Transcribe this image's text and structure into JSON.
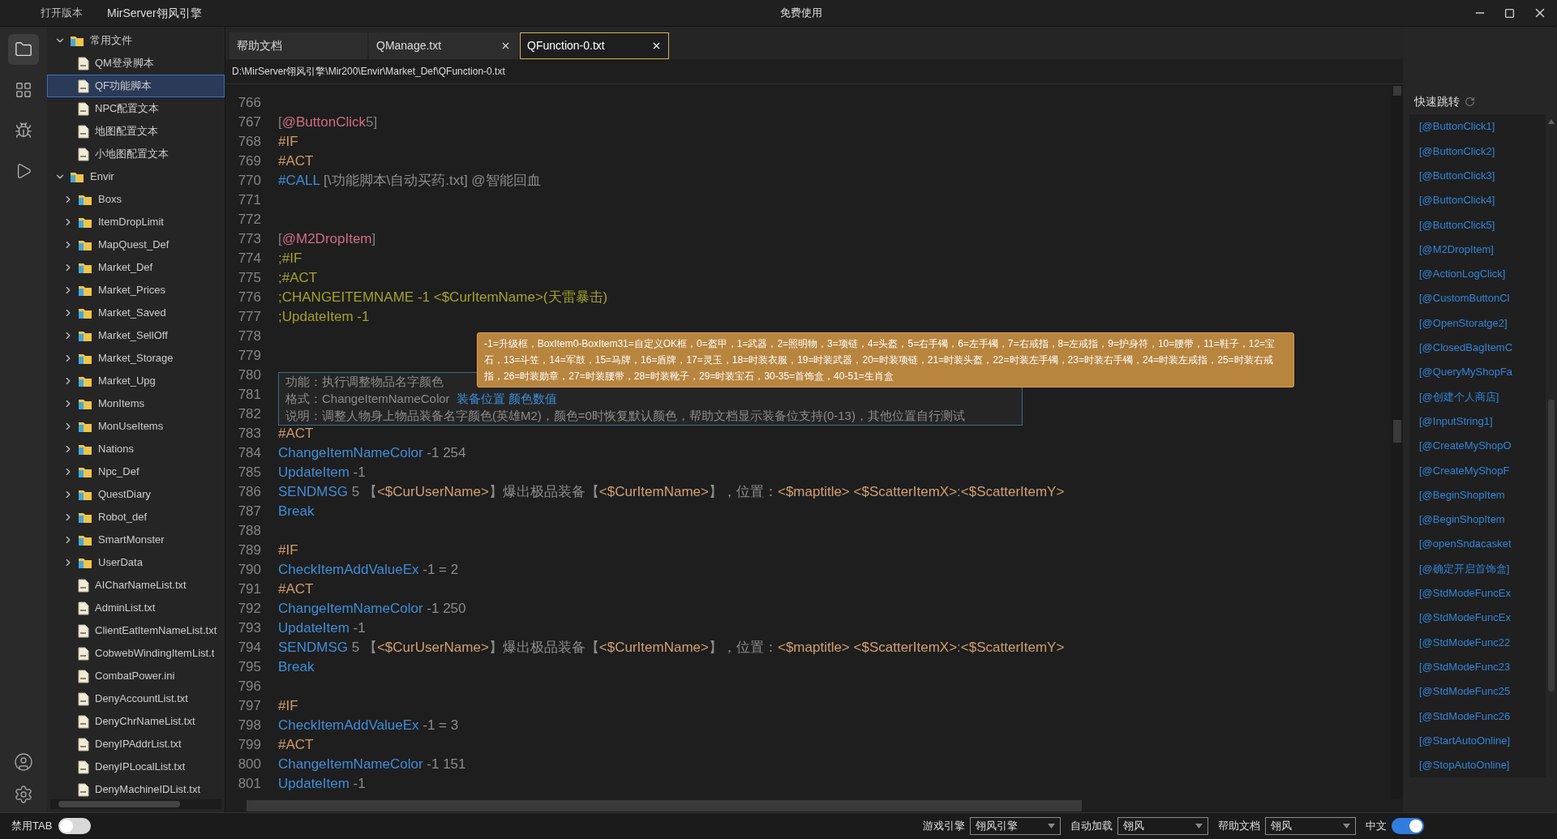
{
  "title_bar": {
    "menu": "打开版本",
    "title": "MirServer翎风引擎",
    "center": "免费使用"
  },
  "activity_bar": [
    {
      "kind": "folder",
      "selected": true
    },
    {
      "kind": "grid",
      "selected": false
    },
    {
      "kind": "bug",
      "selected": false
    },
    {
      "kind": "play",
      "selected": false
    }
  ],
  "activity_bottom": [
    {
      "kind": "user"
    },
    {
      "kind": "settings"
    }
  ],
  "tree": [
    {
      "kind": "folder",
      "label": "常用文件",
      "expanded": true,
      "selected": false,
      "children": [
        {
          "kind": "file",
          "label": "QM登录脚本",
          "selected": false
        },
        {
          "kind": "file",
          "label": "QF功能脚本",
          "selected": true
        },
        {
          "kind": "file",
          "label": "NPC配置文本",
          "selected": false
        },
        {
          "kind": "file",
          "label": "地图配置文本",
          "selected": false
        },
        {
          "kind": "file",
          "label": "小地图配置文本",
          "selected": false
        }
      ]
    },
    {
      "kind": "folder",
      "label": "Envir",
      "expanded": true,
      "selected": false,
      "children": [
        {
          "kind": "folder",
          "label": "Boxs",
          "expanded": false,
          "selected": false
        },
        {
          "kind": "folder",
          "label": "ItemDropLimit",
          "expanded": false,
          "selected": false
        },
        {
          "kind": "folder",
          "label": "MapQuest_Def",
          "expanded": false,
          "selected": false
        },
        {
          "kind": "folder",
          "label": "Market_Def",
          "expanded": false,
          "selected": false
        },
        {
          "kind": "folder",
          "label": "Market_Prices",
          "expanded": false,
          "selected": false
        },
        {
          "kind": "folder",
          "label": "Market_Saved",
          "expanded": false,
          "selected": false
        },
        {
          "kind": "folder",
          "label": "Market_SellOff",
          "expanded": false,
          "selected": false
        },
        {
          "kind": "folder",
          "label": "Market_Storage",
          "expanded": false,
          "selected": false
        },
        {
          "kind": "folder",
          "label": "Market_Upg",
          "expanded": false,
          "selected": false
        },
        {
          "kind": "folder",
          "label": "MonItems",
          "expanded": false,
          "selected": false
        },
        {
          "kind": "folder",
          "label": "MonUseItems",
          "expanded": false,
          "selected": false
        },
        {
          "kind": "folder",
          "label": "Nations",
          "expanded": false,
          "selected": false
        },
        {
          "kind": "folder",
          "label": "Npc_Def",
          "expanded": false,
          "selected": false
        },
        {
          "kind": "folder",
          "label": "QuestDiary",
          "expanded": false,
          "selected": false
        },
        {
          "kind": "folder",
          "label": "Robot_def",
          "expanded": false,
          "selected": false
        },
        {
          "kind": "folder",
          "label": "SmartMonster",
          "expanded": false,
          "selected": false
        },
        {
          "kind": "folder",
          "label": "UserData",
          "expanded": false,
          "selected": false
        },
        {
          "kind": "file",
          "label": "AICharNameList.txt",
          "selected": false
        },
        {
          "kind": "file",
          "label": "AdminList.txt",
          "selected": false
        },
        {
          "kind": "file",
          "label": "ClientEatItemNameList.txt",
          "selected": false
        },
        {
          "kind": "file",
          "label": "CobwebWindingItemList.t",
          "selected": false
        },
        {
          "kind": "file",
          "label": "CombatPower.ini",
          "selected": false
        },
        {
          "kind": "file",
          "label": "DenyAccountList.txt",
          "selected": false
        },
        {
          "kind": "file",
          "label": "DenyChrNameList.txt",
          "selected": false
        },
        {
          "kind": "file",
          "label": "DenyIPAddrList.txt",
          "selected": false
        },
        {
          "kind": "file",
          "label": "DenyIPLocalList.txt",
          "selected": false
        },
        {
          "kind": "file",
          "label": "DenyMachineIDList.txt",
          "selected": false
        }
      ]
    }
  ],
  "tabs": [
    {
      "label": "帮助文档",
      "closable": false,
      "selected": false
    },
    {
      "label": "QManage.txt",
      "closable": true,
      "selected": false
    },
    {
      "label": "QFunction-0.txt",
      "closable": true,
      "selected": true
    }
  ],
  "path": "D:\\MirServer翎风引擎\\Mir200\\Envir\\Market_Def\\QFunction-0.txt",
  "code_lines": [
    {
      "number": "766"
    },
    {
      "number": "767",
      "tokens": [
        {
          "kind": "punct",
          "text": "["
        },
        {
          "kind": "label",
          "text": "@ButtonClick"
        },
        {
          "kind": "punct",
          "text": "5]"
        }
      ]
    },
    {
      "number": "768",
      "tokens": [
        {
          "kind": "directive",
          "text": "#IF"
        }
      ]
    },
    {
      "number": "769",
      "tokens": [
        {
          "kind": "directive",
          "text": "#ACT"
        }
      ]
    },
    {
      "number": "770",
      "tokens": [
        {
          "kind": "command",
          "text": "#CALL"
        },
        {
          "kind": "arg",
          "text": " [\\功能脚本\\自动买药.txt] @智能回血"
        }
      ]
    },
    {
      "number": "771"
    },
    {
      "number": "772"
    },
    {
      "number": "773",
      "tokens": [
        {
          "kind": "punct",
          "text": "["
        },
        {
          "kind": "label",
          "text": "@M2DropItem"
        },
        {
          "kind": "punct",
          "text": "]"
        }
      ]
    },
    {
      "number": "774",
      "tokens": [
        {
          "kind": "comment",
          "text": ";#IF"
        }
      ]
    },
    {
      "number": "775",
      "tokens": [
        {
          "kind": "comment",
          "text": ";#ACT"
        }
      ]
    },
    {
      "number": "776",
      "tokens": [
        {
          "kind": "comment",
          "text": ";CHANGEITEMNAME -1 <$CurItemName>(天雷暴击)"
        }
      ]
    },
    {
      "number": "777",
      "tokens": [
        {
          "kind": "comment",
          "text": ";UpdateItem -1"
        }
      ]
    },
    {
      "number": "778"
    },
    {
      "number": "779"
    },
    {
      "number": "780"
    },
    {
      "number": "781"
    },
    {
      "number": "782"
    },
    {
      "number": "783",
      "tokens": [
        {
          "kind": "directive",
          "text": "#ACT"
        }
      ]
    },
    {
      "number": "784",
      "tokens": [
        {
          "kind": "command",
          "text": "ChangeItemNameColor"
        },
        {
          "kind": "arg",
          "text": " -1 254"
        }
      ]
    },
    {
      "number": "785",
      "tokens": [
        {
          "kind": "command",
          "text": "UpdateItem"
        },
        {
          "kind": "arg",
          "text": " -1"
        }
      ]
    },
    {
      "number": "786",
      "tokens": [
        {
          "kind": "command",
          "text": "SENDMSG"
        },
        {
          "kind": "arg",
          "text": " 5 【"
        },
        {
          "kind": "var",
          "text": "<$CurUserName>"
        },
        {
          "kind": "arg",
          "text": "】爆出极品装备【"
        },
        {
          "kind": "var",
          "text": "<$CurItemName>"
        },
        {
          "kind": "arg",
          "text": "】，位置："
        },
        {
          "kind": "var",
          "text": "<$maptitle> <$ScatterItemX>"
        },
        {
          "kind": "arg",
          "text": ":"
        },
        {
          "kind": "var",
          "text": "<$ScatterItemY>"
        }
      ]
    },
    {
      "number": "787",
      "tokens": [
        {
          "kind": "command",
          "text": "Break"
        }
      ]
    },
    {
      "number": "788"
    },
    {
      "number": "789",
      "tokens": [
        {
          "kind": "directive",
          "text": "#IF"
        }
      ]
    },
    {
      "number": "790",
      "tokens": [
        {
          "kind": "command",
          "text": "CheckItemAddValueEx"
        },
        {
          "kind": "arg",
          "text": " -1 = 2"
        }
      ]
    },
    {
      "number": "791",
      "tokens": [
        {
          "kind": "directive",
          "text": "#ACT"
        }
      ]
    },
    {
      "number": "792",
      "tokens": [
        {
          "kind": "command",
          "text": "ChangeItemNameColor"
        },
        {
          "kind": "arg",
          "text": " -1 250"
        }
      ]
    },
    {
      "number": "793",
      "tokens": [
        {
          "kind": "command",
          "text": "UpdateItem"
        },
        {
          "kind": "arg",
          "text": " -1"
        }
      ]
    },
    {
      "number": "794",
      "tokens": [
        {
          "kind": "command",
          "text": "SENDMSG"
        },
        {
          "kind": "arg",
          "text": " 5 【"
        },
        {
          "kind": "var",
          "text": "<$CurUserName>"
        },
        {
          "kind": "arg",
          "text": "】爆出极品装备【"
        },
        {
          "kind": "var",
          "text": "<$CurItemName>"
        },
        {
          "kind": "arg",
          "text": "】，位置："
        },
        {
          "kind": "var",
          "text": "<$maptitle> <$ScatterItemX>"
        },
        {
          "kind": "arg",
          "text": ":"
        },
        {
          "kind": "var",
          "text": "<$ScatterItemY>"
        }
      ]
    },
    {
      "number": "795",
      "tokens": [
        {
          "kind": "command",
          "text": "Break"
        }
      ]
    },
    {
      "number": "796"
    },
    {
      "number": "797",
      "tokens": [
        {
          "kind": "directive",
          "text": "#IF"
        }
      ]
    },
    {
      "number": "798",
      "tokens": [
        {
          "kind": "command",
          "text": "CheckItemAddValueEx"
        },
        {
          "kind": "arg",
          "text": " -1 = 3"
        }
      ]
    },
    {
      "number": "799",
      "tokens": [
        {
          "kind": "directive",
          "text": "#ACT"
        }
      ]
    },
    {
      "number": "800",
      "tokens": [
        {
          "kind": "command",
          "text": "ChangeItemNameColor"
        },
        {
          "kind": "arg",
          "text": " -1 151"
        }
      ]
    },
    {
      "number": "801",
      "tokens": [
        {
          "kind": "command",
          "text": "UpdateItem"
        },
        {
          "kind": "arg",
          "text": " -1"
        }
      ]
    }
  ],
  "hover_info": {
    "function": "功能：执行调整物品名字颜色",
    "format_label": "格式：ChangeItemNameColor",
    "format_params": "装备位置 颜色数值",
    "description": "说明：调整人物身上物品装备名字颜色(英雄M2)，颜色=0时恢复默认颜色，帮助文档显示装备位支持(0-13)，其他位置自行测试"
  },
  "param_tooltip": "-1=升级框，BoxItem0-BoxItem31=自定义OK框，0=盔甲，1=武器，2=照明物，3=项链，4=头盔，5=右手镯，6=左手镯，7=右戒指，8=左戒指，9=护身符，10=腰带，11=鞋子，12=宝石，13=斗笠，14=军鼓，15=马牌，16=盾牌，17=灵玉，18=时装衣服，19=时装武器，20=时装项链，21=时装头盔，22=时装左手镯，23=时装右手镯，24=时装左戒指，25=时装右戒指，26=时装勋章，27=时装腰带，28=时装靴子，29=时装宝石，30-35=首饰盒，40-51=生肖盒",
  "quick_jump": {
    "title": "快速跳转",
    "items": [
      "[@ButtonClick1]",
      "[@ButtonClick2]",
      "[@ButtonClick3]",
      "[@ButtonClick4]",
      "[@ButtonClick5]",
      "[@M2DropItem]",
      "[@ActionLogClick]",
      "[@CustomButtonCl",
      "[@OpenStoratge2]",
      "[@ClosedBagItemC",
      "[@QueryMyShopFa",
      "[@创建个人商店]",
      "[@InputString1]",
      "[@CreateMyShopO",
      "[@CreateMyShopF",
      "[@BeginShopItem",
      "[@BeginShopItem",
      "[@openSndacasket",
      "[@确定开启首饰盒]",
      "[@StdModeFuncEx",
      "[@StdModeFuncEx",
      "[@StdModeFunc22",
      "[@StdModeFunc23",
      "[@StdModeFunc25",
      "[@StdModeFunc26",
      "[@StartAutoOnline]",
      "[@StopAutoOnline]"
    ]
  },
  "status_bar": {
    "tab_toggle": {
      "label": "禁用TAB",
      "on": false
    },
    "selects": [
      {
        "label": "游戏引擎",
        "value": "翎风引擎"
      },
      {
        "label": "自动加载",
        "value": "翎风"
      },
      {
        "label": "帮助文档",
        "value": "翎风"
      }
    ],
    "language_toggle": {
      "label": "中文",
      "on": true
    }
  }
}
